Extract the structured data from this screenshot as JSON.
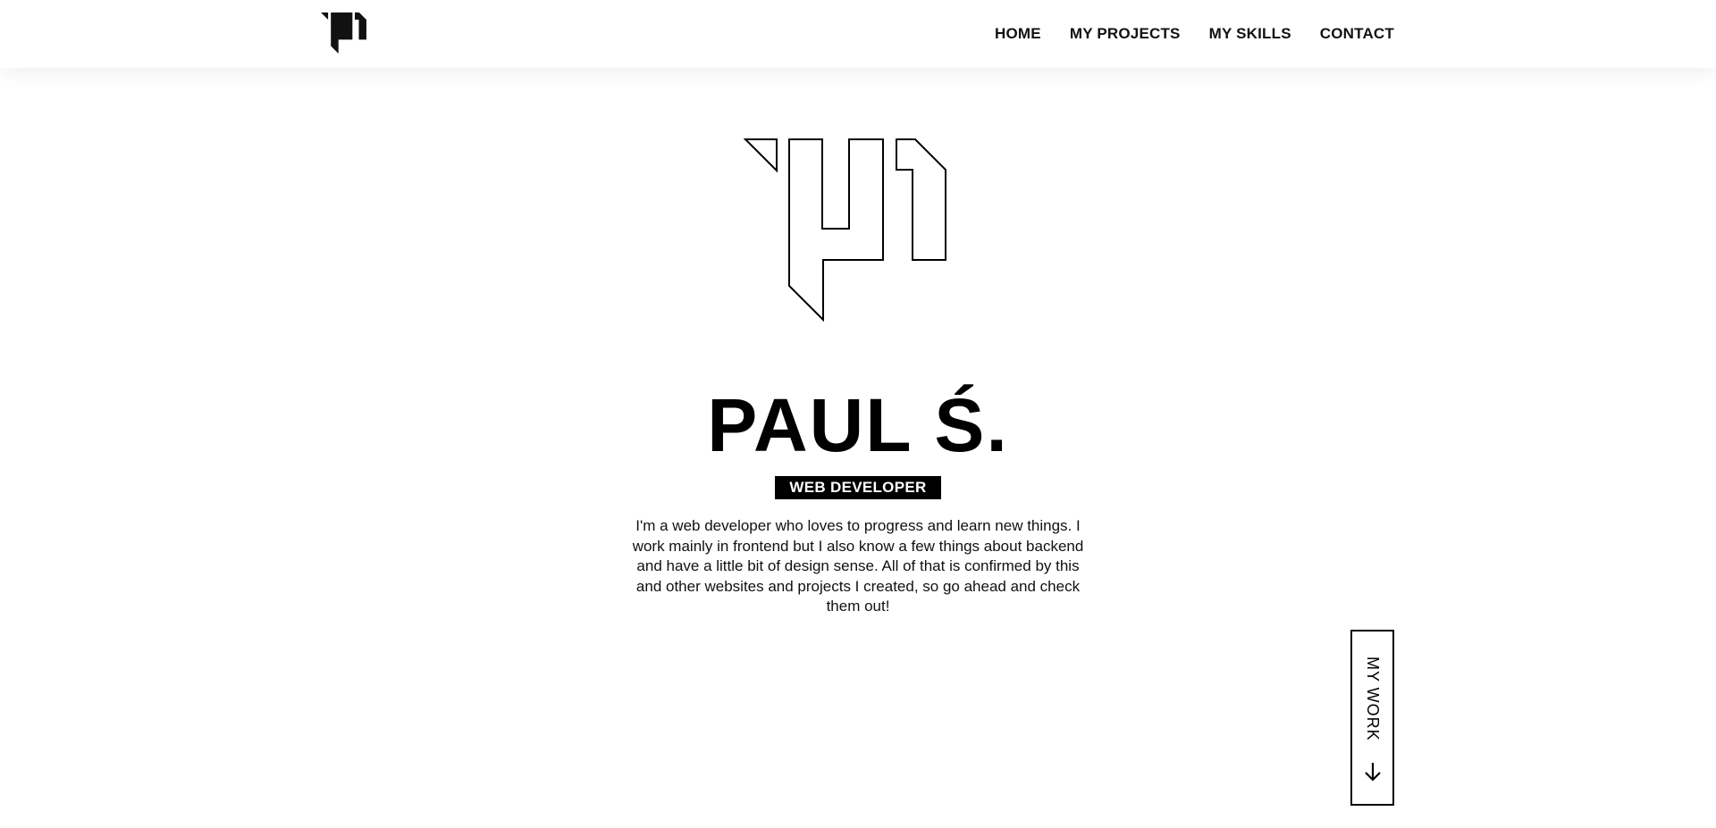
{
  "logo": {
    "icon": "pś-monogram-icon"
  },
  "nav": {
    "items": [
      {
        "label": "HOME"
      },
      {
        "label": "MY PROJECTS"
      },
      {
        "label": "MY SKILLS"
      },
      {
        "label": "CONTACT"
      }
    ]
  },
  "hero": {
    "logo_icon": "pś-monogram-outline-icon",
    "name": "PAUL Ś.",
    "role": "WEB DEVELOPER",
    "bio": "I'm a web developer who loves to progress and learn new things. I work mainly in frontend but I also know a few things about backend and have a little bit of design sense. All of that is confirmed by this and other websites and projects I created, so go ahead and check them out!"
  },
  "scroll_button": {
    "label": "MY WORK",
    "icon": "arrow-down-icon"
  },
  "colors": {
    "background": "#ffffff",
    "text": "#000000",
    "badge_bg": "#000000",
    "badge_text": "#ffffff"
  }
}
